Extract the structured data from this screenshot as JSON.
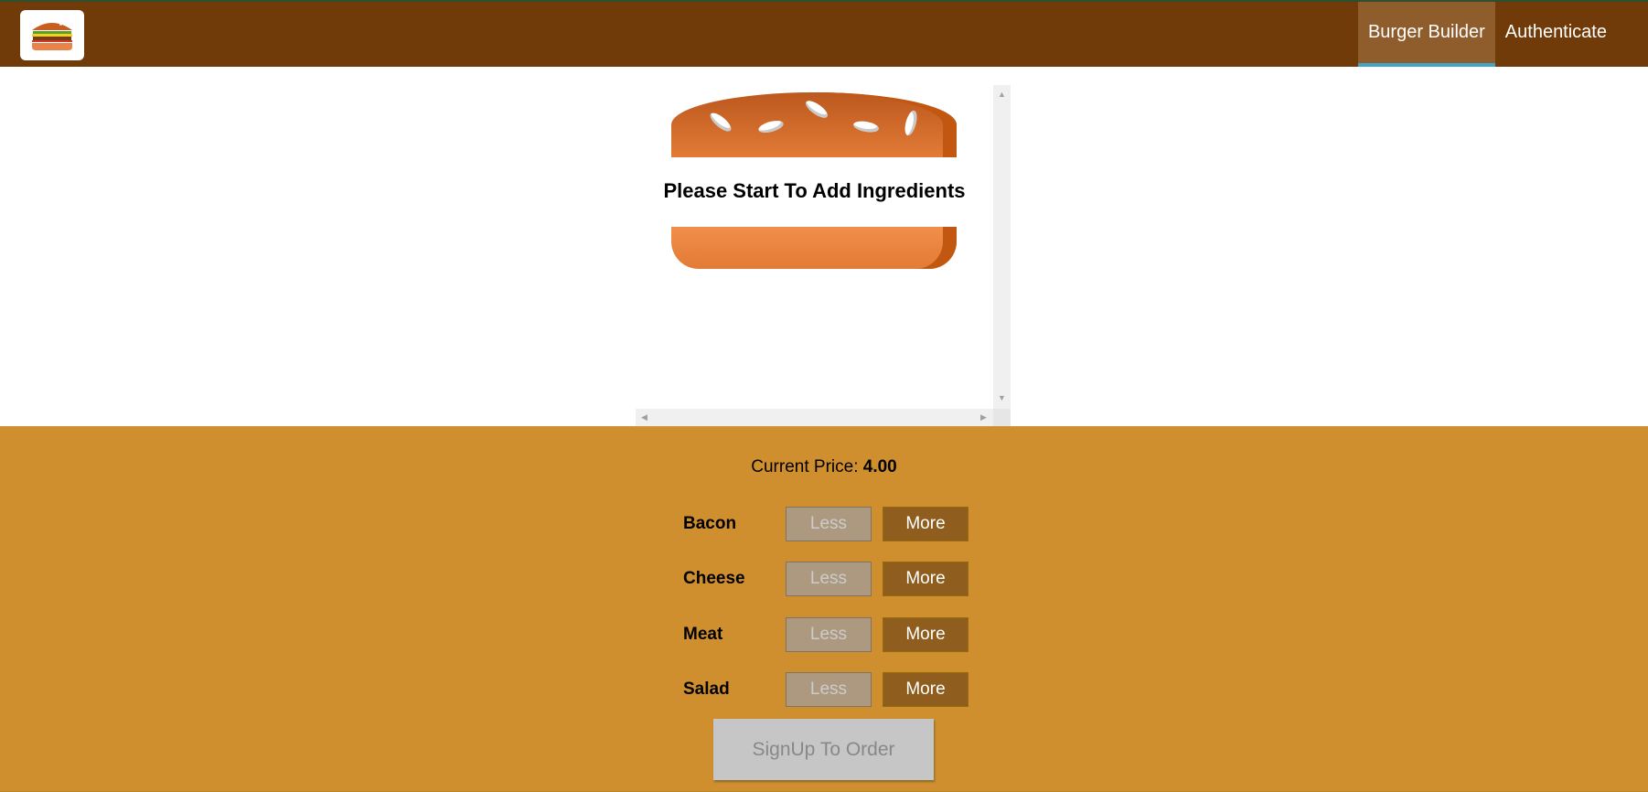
{
  "toolbar": {
    "logo": "burger-logo",
    "nav": [
      {
        "label": "Burger Builder",
        "active": true
      },
      {
        "label": "Authenticate",
        "active": false
      }
    ]
  },
  "burger": {
    "message": "Please Start To Add Ingredients"
  },
  "controls": {
    "price_label": "Current Price:",
    "price_value": "4.00",
    "ingredients": [
      {
        "label": "Bacon",
        "less": "Less",
        "more": "More"
      },
      {
        "label": "Cheese",
        "less": "Less",
        "more": "More"
      },
      {
        "label": "Meat",
        "less": "Less",
        "more": "More"
      },
      {
        "label": "Salad",
        "less": "Less",
        "more": "More"
      }
    ],
    "order_button": "SignUp To Order"
  },
  "colors": {
    "toolbar": "#703b09",
    "controls_bg": "#cf8f2e",
    "more_button": "#8f5e1e",
    "less_button": "#ac9980",
    "active_underline": "#40a4c8"
  }
}
